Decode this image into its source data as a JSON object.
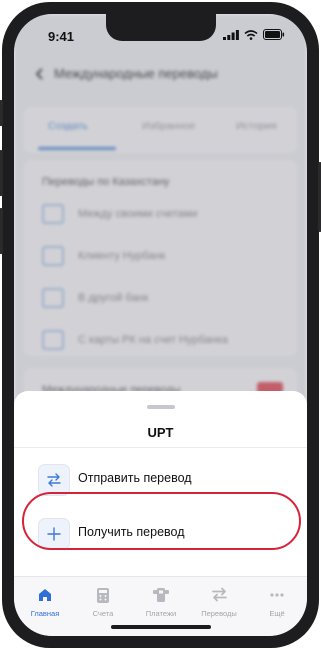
{
  "status_bar": {
    "time": "9:41"
  },
  "background_screen": {
    "title": "Международные переводы",
    "tabs": [
      "Создать",
      "Избранное",
      "История"
    ],
    "section_title": "Переводы по Казахстану",
    "items": [
      "Между своими счетами",
      "Клиенту Нурбанк",
      "В другой банк",
      "С карты РК на счет Нурбанка"
    ],
    "section2_title": "Международные переводы"
  },
  "sheet": {
    "title": "UPT",
    "options": [
      {
        "label": "Отправить перевод",
        "icon": "transfer-arrows-icon"
      },
      {
        "label": "Получить перевод",
        "icon": "plus-icon"
      }
    ]
  },
  "tabbar": {
    "items": [
      {
        "label": "Главная",
        "icon": "home-icon",
        "active": true
      },
      {
        "label": "Счета",
        "icon": "calculator-icon",
        "active": false
      },
      {
        "label": "Платежи",
        "icon": "payment-terminal-icon",
        "active": false
      },
      {
        "label": "Переводы",
        "icon": "transfer-arrows-icon",
        "active": false
      },
      {
        "label": "Ещё",
        "icon": "more-dots-icon",
        "active": false
      }
    ]
  },
  "colors": {
    "accent": "#2f6fd6",
    "highlight": "#d5243a",
    "badge": "#e05562"
  }
}
